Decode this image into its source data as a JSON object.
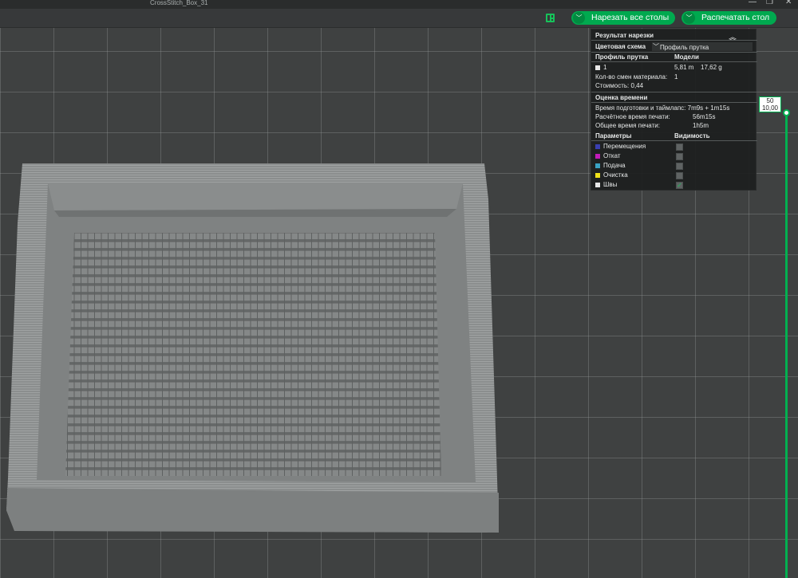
{
  "window": {
    "title": "CrossStitch_Box_31"
  },
  "toolbar": {
    "slice_all_label": "Нарезать все столы",
    "print_plate_label": "Распечатать стол"
  },
  "slice_result": {
    "header": "Результат нарезки",
    "color_scheme_label": "Цветовая схема",
    "color_scheme_value": "Профиль прутка",
    "col_filament": "Профиль прутка",
    "col_models": "Модели",
    "filament": {
      "id": "1",
      "length": "5,81 m",
      "weight": "17,62 g"
    },
    "material_changes_label": "Кол-во смен материала:",
    "material_changes_value": "1",
    "cost_label": "Стоимость: 0,44",
    "time_header": "Оценка времени",
    "prep_time": "Время подготовки и таймлапс: 7m9s + 1m15s",
    "calc_time_label": "Расчётное время печати:",
    "calc_time_value": "56m15s",
    "total_time_label": "Общее время печати:",
    "total_time_value": "1h5m",
    "params_header": "Параметры",
    "visibility_header": "Видимость",
    "params": [
      {
        "label": "Перемещения",
        "color": "#3a3fb0",
        "visible": false
      },
      {
        "label": "Откат",
        "color": "#c21bb8",
        "visible": false
      },
      {
        "label": "Подача",
        "color": "#3aa3c4",
        "visible": false
      },
      {
        "label": "Очистка",
        "color": "#f0e21a",
        "visible": false
      },
      {
        "label": "Швы",
        "color": "#e8e8e8",
        "visible": true
      }
    ]
  },
  "layer_slider": {
    "layer": "50",
    "height": "10,00"
  },
  "colors": {
    "accent": "#00a94f",
    "background": "#3f4141"
  }
}
